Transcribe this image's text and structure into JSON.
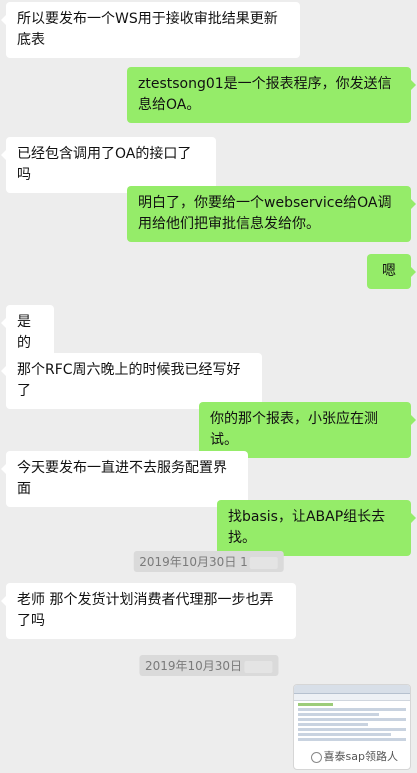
{
  "messages": [
    {
      "side": "left",
      "text": "所以要发布一个WS用于接收审批结果更新底表"
    },
    {
      "side": "right",
      "text": "ztestsong01是一个报表程序，你发送信息给OA。"
    },
    {
      "side": "left",
      "text": "已经包含调用了OA的接口了吗"
    },
    {
      "side": "right",
      "text": "明白了，你要给一个webservice给OA调用给他们把审批信息发给你。"
    },
    {
      "side": "right",
      "text": "嗯"
    },
    {
      "side": "left",
      "text": "是的"
    },
    {
      "side": "left",
      "text": "那个RFC周六晚上的时候我已经写好了"
    },
    {
      "side": "right",
      "text": "你的那个报表，小张应在测试。"
    },
    {
      "side": "left",
      "text": "今天要发布一直进不去服务配置界面"
    },
    {
      "side": "right",
      "text": "找basis，让ABAP组长去找。"
    },
    {
      "side": "left",
      "text": "老师 那个发货计划消费者代理那一步也弄了吗"
    }
  ],
  "timestamps": [
    "2019年10月30日 1",
    "2019年10月30日"
  ],
  "image_watermark": "喜泰sap领路人",
  "colors": {
    "background": "#ededed",
    "sent_bubble": "#95ec69",
    "received_bubble": "#ffffff"
  }
}
